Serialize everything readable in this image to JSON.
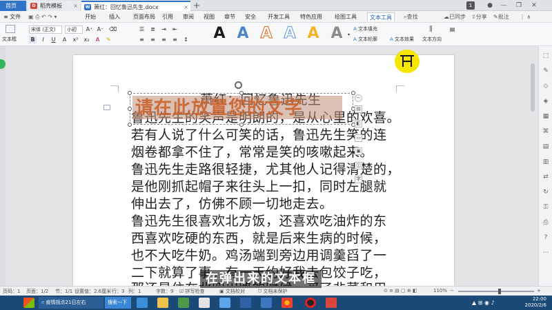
{
  "tabs": {
    "home": "首页",
    "template": "稻壳模板",
    "document": "萧红：回忆鲁迅先生.docx",
    "new_tab": "+"
  },
  "window": {
    "badge": "1"
  },
  "menu": {
    "file": "文件",
    "items": [
      "开始",
      "插入",
      "页面布局",
      "引用",
      "审阅",
      "视图",
      "章节",
      "安全",
      "开发工具",
      "特色应用",
      "绘图工具"
    ],
    "active": "文本工具",
    "search": "查找",
    "sync": "已同步",
    "share": "分享",
    "comment": "批注"
  },
  "ribbon": {
    "font_name": "宋体 (正文)",
    "font_size": "小初",
    "textbox_label": "文本框",
    "wordart_styles": [
      "A",
      "A",
      "A",
      "A",
      "A",
      "A"
    ],
    "text_fill": "文本填充",
    "text_outline": "文本轮廓",
    "text_effect": "文本效果",
    "text_direction": "文本方向"
  },
  "document": {
    "title_line": "萧红：回忆鲁迅先生",
    "lines": [
      "鲁迅先生的笑声是明朗的，是从心里的欢喜。",
      "若有人说了什么可笑的话，鲁迅先生笑的连",
      "烟卷都拿不住了，常常是笑的咳嗽起来。",
      "鲁迅先生走路很轻捷，尤其他人记得清楚的，",
      "是他刚抓起帽子来往头上一扣，同时左腿就",
      "伸出去了，仿佛不顾一切地走去。",
      "鲁迅先生很喜欢北方饭，还喜欢吃油炸的东",
      "西喜欢吃硬的东西，就是后来生病的时候，",
      "也不大吃牛奶。鸡汤端到旁边用调羹舀了一",
      "二下就算了事。有一天约好我去包饺子吃，",
      "那还是住在北四川路的时候，买了韭菜和用"
    ],
    "textbox_placeholder": "请在此放置您的文字"
  },
  "statusbar": {
    "page": "页码：1",
    "pages": "页面：1/2",
    "section": "节：1/1",
    "setting": "设置值：2.6厘米",
    "row": "行：3",
    "col": "列：1",
    "words": "字数：9",
    "spell": "拼写检查",
    "proofread": "文档校对",
    "unprotected": "文档未保护",
    "zoom": "110%"
  },
  "taskbar": {
    "browser": "疫情拐点21日左右",
    "search": "搜索一下",
    "time": "22:00",
    "date": "2020/2/6"
  },
  "subtitle": "在弹出来的文本框",
  "colors": {
    "accent": "#2f73c9",
    "wordart": [
      "#1a1a1a",
      "#4a86c8",
      "#e07a3a",
      "#7aa8d8",
      "#f2b32a",
      "#8a8a8a"
    ],
    "placeholder": "#c9622c",
    "taskbar": "#1c4a78"
  }
}
